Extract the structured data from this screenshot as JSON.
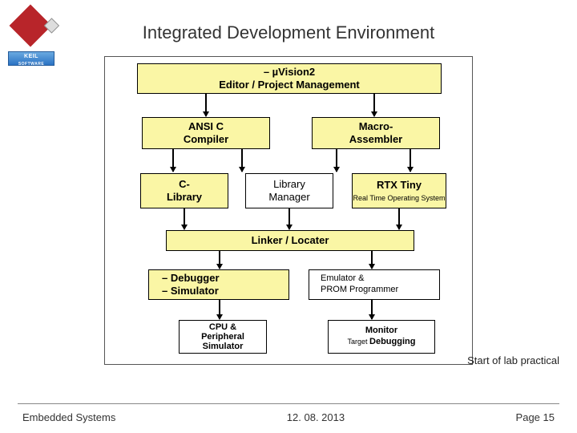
{
  "logo": {
    "top_label": "",
    "brand": "KEIL",
    "brand_sub": "SOFTWARE"
  },
  "title": "Integrated Development Environment",
  "boxes": {
    "editor_l1": "– µVision2",
    "editor_l2": "Editor / Project Management",
    "ansi_l1": "ANSI C",
    "ansi_l2": "Compiler",
    "macro_l1": "Macro-",
    "macro_l2": "Assembler",
    "clib_l1": "C-",
    "clib_l2": "Library",
    "libmgr_l1": "Library",
    "libmgr_l2": "Manager",
    "rtx_title": "RTX Tiny",
    "rtx_sub": "Real Time Operating System",
    "linker": "Linker / Locater",
    "dbg_l1": "– Debugger",
    "dbg_l2": "– Simulator",
    "emu_l1": "Emulator &",
    "emu_l2": "PROM Programmer",
    "cpu_l1": "CPU &",
    "cpu_l2": "Peripheral",
    "cpu_l3": "Simulator",
    "mon_l1": "Monitor",
    "mon_l2a": "Target ",
    "mon_l2b": "Debugging"
  },
  "side_note": "Start of lab practical",
  "footer": {
    "left": "Embedded Systems",
    "center": "12. 08. 2013",
    "right": "Page 15"
  }
}
